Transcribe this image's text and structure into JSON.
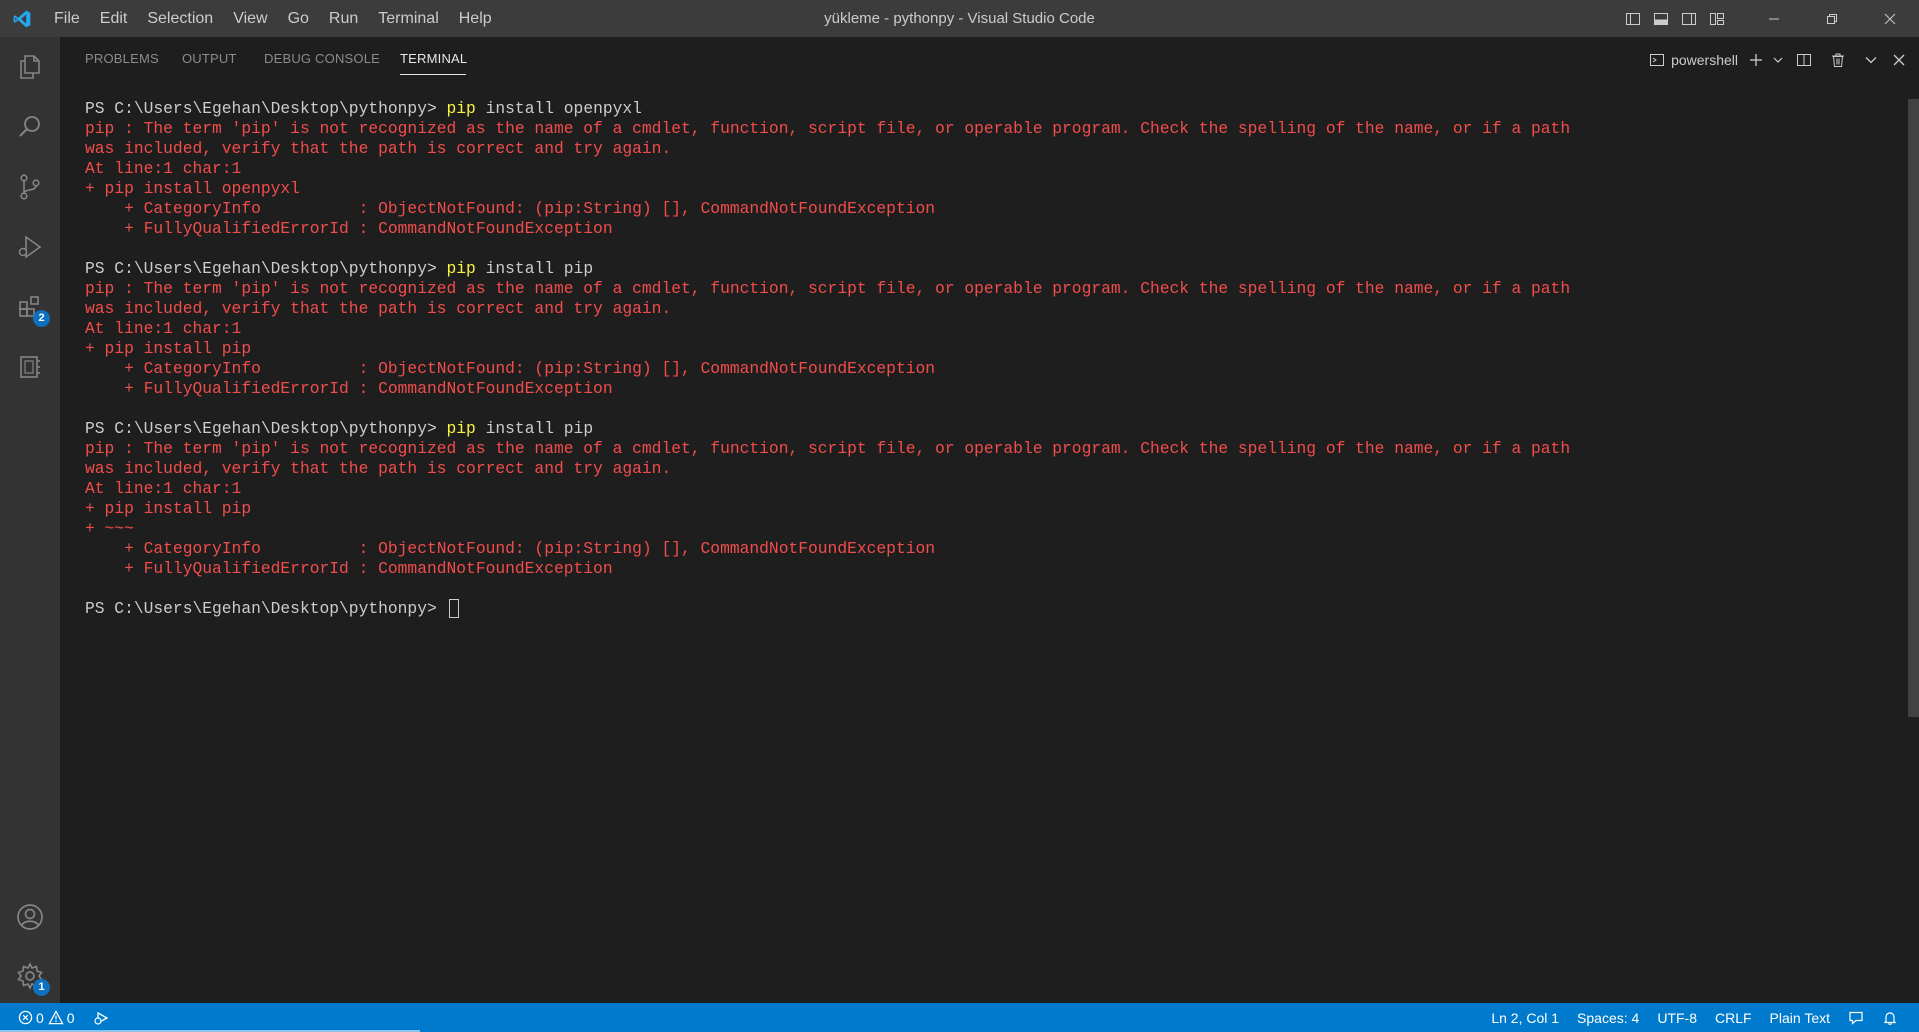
{
  "titlebar": {
    "menu": [
      "File",
      "Edit",
      "Selection",
      "View",
      "Go",
      "Run",
      "Terminal",
      "Help"
    ],
    "window_title": "yükleme - pythonpy - Visual Studio Code"
  },
  "activitybar": {
    "extensions_badge": "2",
    "settings_badge": "1"
  },
  "panel": {
    "tabs": [
      "PROBLEMS",
      "OUTPUT",
      "DEBUG CONSOLE",
      "TERMINAL"
    ],
    "active_tab": "TERMINAL",
    "shell_name": "powershell"
  },
  "terminal": {
    "prompt": "PS C:\\Users\\Egehan\\Desktop\\pythonpy>",
    "blocks": [
      {
        "command": "pip",
        "args": "install openpyxl",
        "error_lines": [
          "pip : The term 'pip' is not recognized as the name of a cmdlet, function, script file, or operable program. Check the spelling of the name, or if a path",
          "was included, verify that the path is correct and try again.",
          "At line:1 char:1",
          "+ pip install openpyxl",
          "    + CategoryInfo          : ObjectNotFound: (pip:String) [], CommandNotFoundException",
          "    + FullyQualifiedErrorId : CommandNotFoundException"
        ]
      },
      {
        "command": "pip",
        "args": "install pip",
        "error_lines": [
          "pip : The term 'pip' is not recognized as the name of a cmdlet, function, script file, or operable program. Check the spelling of the name, or if a path",
          "was included, verify that the path is correct and try again.",
          "At line:1 char:1",
          "+ pip install pip",
          "    + CategoryInfo          : ObjectNotFound: (pip:String) [], CommandNotFoundException",
          "    + FullyQualifiedErrorId : CommandNotFoundException"
        ]
      },
      {
        "command": "pip",
        "args": "install pip",
        "error_lines": [
          "pip : The term 'pip' is not recognized as the name of a cmdlet, function, script file, or operable program. Check the spelling of the name, or if a path",
          "was included, verify that the path is correct and try again.",
          "At line:1 char:1",
          "+ pip install pip",
          "+ ~~~",
          "    + CategoryInfo          : ObjectNotFound: (pip:String) [], CommandNotFoundException",
          "    + FullyQualifiedErrorId : CommandNotFoundException"
        ]
      }
    ]
  },
  "statusbar": {
    "errors": "0",
    "warnings": "0",
    "cursor_position": "Ln 2, Col 1",
    "indentation": "Spaces: 4",
    "encoding": "UTF-8",
    "line_ending": "CRLF",
    "language": "Plain Text"
  },
  "colors": {
    "titlebar_bg": "#3c3c3c",
    "activitybar_bg": "#333333",
    "editor_bg": "#1e1e1e",
    "statusbar_bg": "#007acc",
    "error_text": "#f14c4c",
    "command_text": "#f5f543",
    "accent_blue": "#0e70c0"
  }
}
